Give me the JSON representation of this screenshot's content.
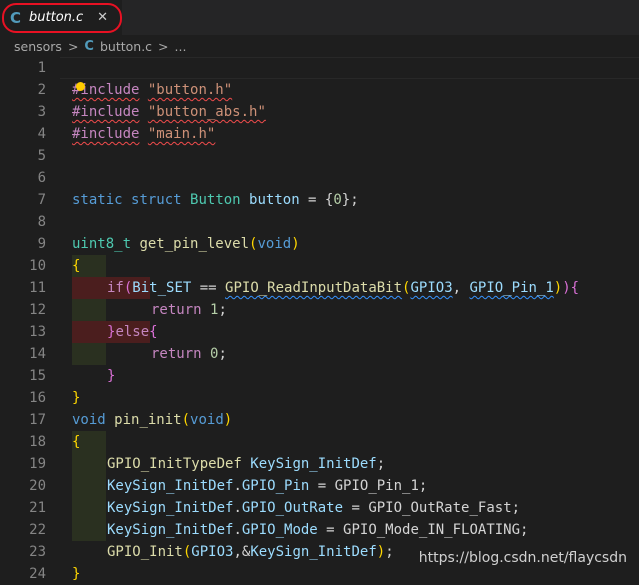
{
  "tab": {
    "lang_icon": "C",
    "filename": "button.c",
    "close_glyph": "✕"
  },
  "breadcrumb": {
    "folder": "sensors",
    "sep1": ">",
    "lang_icon": "C",
    "file": "button.c",
    "sep2": ">",
    "more": "..."
  },
  "colors": {
    "accent_highlight": "#e81123",
    "background": "#1e1e1e"
  },
  "code_lines": [
    {
      "no": "1"
    },
    {
      "no": "2"
    },
    {
      "no": "3"
    },
    {
      "no": "4"
    },
    {
      "no": "5"
    },
    {
      "no": "6"
    },
    {
      "no": "7"
    },
    {
      "no": "8"
    },
    {
      "no": "9"
    },
    {
      "no": "10"
    },
    {
      "no": "11"
    },
    {
      "no": "12"
    },
    {
      "no": "13"
    },
    {
      "no": "14"
    },
    {
      "no": "15"
    },
    {
      "no": "16"
    },
    {
      "no": "17"
    },
    {
      "no": "18"
    },
    {
      "no": "19"
    },
    {
      "no": "20"
    },
    {
      "no": "21"
    },
    {
      "no": "22"
    },
    {
      "no": "23"
    },
    {
      "no": "24"
    }
  ],
  "code": {
    "l1": {
      "directive": "#include",
      "file": "\"button.h\""
    },
    "l2": {
      "directive": "#include",
      "file": "\"button_abs.h\""
    },
    "l3": {
      "directive": "#include",
      "file": "\"main.h\""
    },
    "l6": {
      "static": "static",
      "struct": "struct",
      "type": "Button",
      "var": "button",
      "eq": " = {",
      "zero": "0",
      "end": "};"
    },
    "l8": {
      "type": "uint8_t",
      "fn": "get_pin_level",
      "open": "(",
      "void": "void",
      "close": ")"
    },
    "l9": {
      "brace": "{"
    },
    "l10": {
      "if": "if",
      "p1": "(",
      "bitset": "Bit_SET",
      "eq": " == ",
      "fn": "GPIO_ReadInputDataBit",
      "p2": "(",
      "gpio": "GPIO3",
      "comma": ", ",
      "pin": "GPIO_Pin_1",
      "p3": ")",
      "p4": ")",
      "brace": "{"
    },
    "l11": {
      "ret": "return",
      "val": "1",
      "semi": ";"
    },
    "l12": {
      "close": "}",
      "else": "else",
      "open": "{"
    },
    "l13": {
      "ret": "return",
      "val": "0",
      "semi": ";"
    },
    "l14": {
      "close": "}"
    },
    "l15": {
      "close": "}"
    },
    "l16": {
      "void": "void",
      "fn": "pin_init",
      "open": "(",
      "void2": "void",
      "close": ")"
    },
    "l17": {
      "brace": "{"
    },
    "l18": {
      "type": "GPIO_InitTypeDef",
      "var": "KeySign_InitDef",
      "semi": ";"
    },
    "l19": {
      "var": "KeySign_InitDef",
      "dot": ".",
      "field": "GPIO_Pin",
      "eq": " = ",
      "val": "GPIO_Pin_1",
      "semi": ";"
    },
    "l20": {
      "var": "KeySign_InitDef",
      "dot": ".",
      "field": "GPIO_OutRate",
      "eq": " = ",
      "val": "GPIO_OutRate_Fast",
      "semi": ";"
    },
    "l21": {
      "var": "KeySign_InitDef",
      "dot": ".",
      "field": "GPIO_Mode",
      "eq": " = ",
      "val": "GPIO_Mode_IN_FLOATING",
      "semi": ";"
    },
    "l22": {
      "fn": "GPIO_Init",
      "open": "(",
      "gpio": "GPIO3",
      "amp": ",&",
      "var": "KeySign_InitDef",
      "close": ")",
      "semi": ";"
    },
    "l23": {
      "brace": "}"
    }
  },
  "watermark": "https://blog.csdn.net/flaycsdn"
}
